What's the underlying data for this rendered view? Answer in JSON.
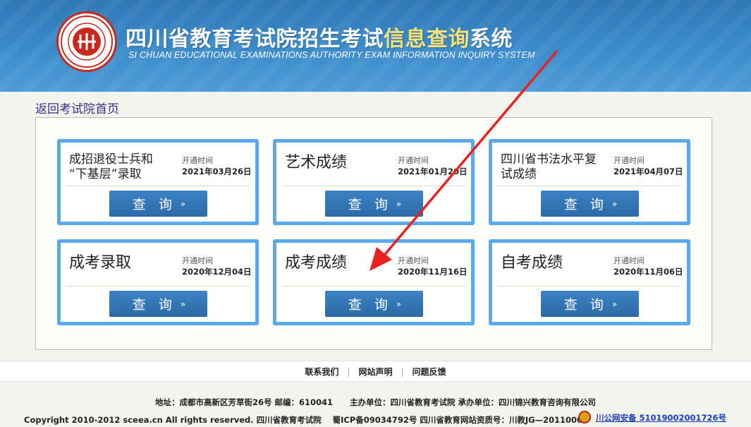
{
  "header": {
    "title_main": "四川省教育考试院招生考试",
    "title_highlight": "信息查询",
    "title_tail": "系统",
    "subtitle": "SI CHUAN EDUCATIONAL EXAMINATIONS AUTHORITY EXAM INFORMATION INQUIRY SYSTEM"
  },
  "back_link": "返回考试院首页",
  "open_label": "开通时间",
  "query_label": "查 询",
  "query_arrow": "»",
  "cards": [
    {
      "name_line1": "成招退役士兵和",
      "name_line2": "“下基层”录取",
      "date": "2021年03月26日"
    },
    {
      "name": "艺术成绩",
      "date": "2021年01月20日"
    },
    {
      "name_line1": "四川省书法水平复",
      "name_line2": "试成绩",
      "date": "2021年04月07日"
    },
    {
      "name": "成考录取",
      "date": "2020年12月04日"
    },
    {
      "name": "成考成绩",
      "date": "2020年11月16日"
    },
    {
      "name": "自考成绩",
      "date": "2020年11月06日"
    }
  ],
  "footer": {
    "links": [
      "联系我们",
      "网站声明",
      "问题反馈"
    ],
    "address": "地址：成都市高新区芳草街26号 邮编：610041",
    "organizer": "主办单位：四川省教育考试院 承办单位：四川锦兴教育咨询有限公司",
    "copyright": "Copyright 2010-2012 sceea.cn All rights reserved. 四川省教育考试院",
    "icp": "蜀ICP备09034792号 四川省教育网站资质号：川教JG—20110002",
    "police": "川公网安备 51019002001726号"
  },
  "colors": {
    "header_blue": "#3b8bcb",
    "card_border": "#5aa9ec",
    "button_blue": "#2c6aa7",
    "annotation_arrow": "#e8231f"
  }
}
